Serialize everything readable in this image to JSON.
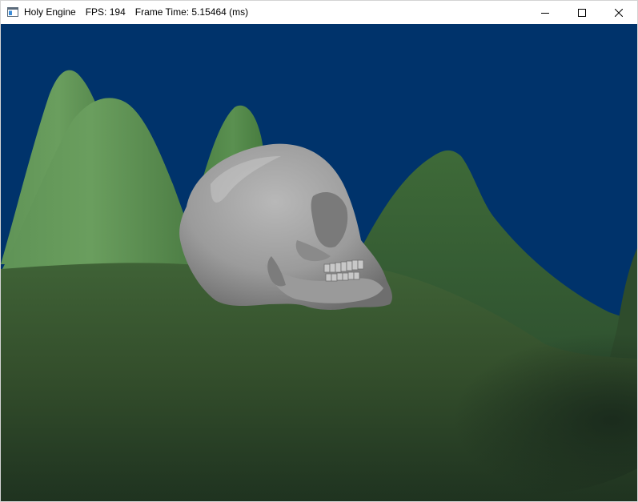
{
  "window": {
    "app_title": "Holy Engine",
    "fps_text": "FPS: 194",
    "frame_time_text": "Frame Time: 5.15464 (ms)"
  },
  "controls": {
    "minimize_icon": "minimize-icon",
    "maximize_icon": "maximize-icon",
    "close_icon": "close-icon"
  },
  "scene": {
    "sky_color": "#00336b",
    "terrain_color": "#3a5a32",
    "hill_color": "#5a8a4e",
    "model_color": "#9a9a9a"
  }
}
